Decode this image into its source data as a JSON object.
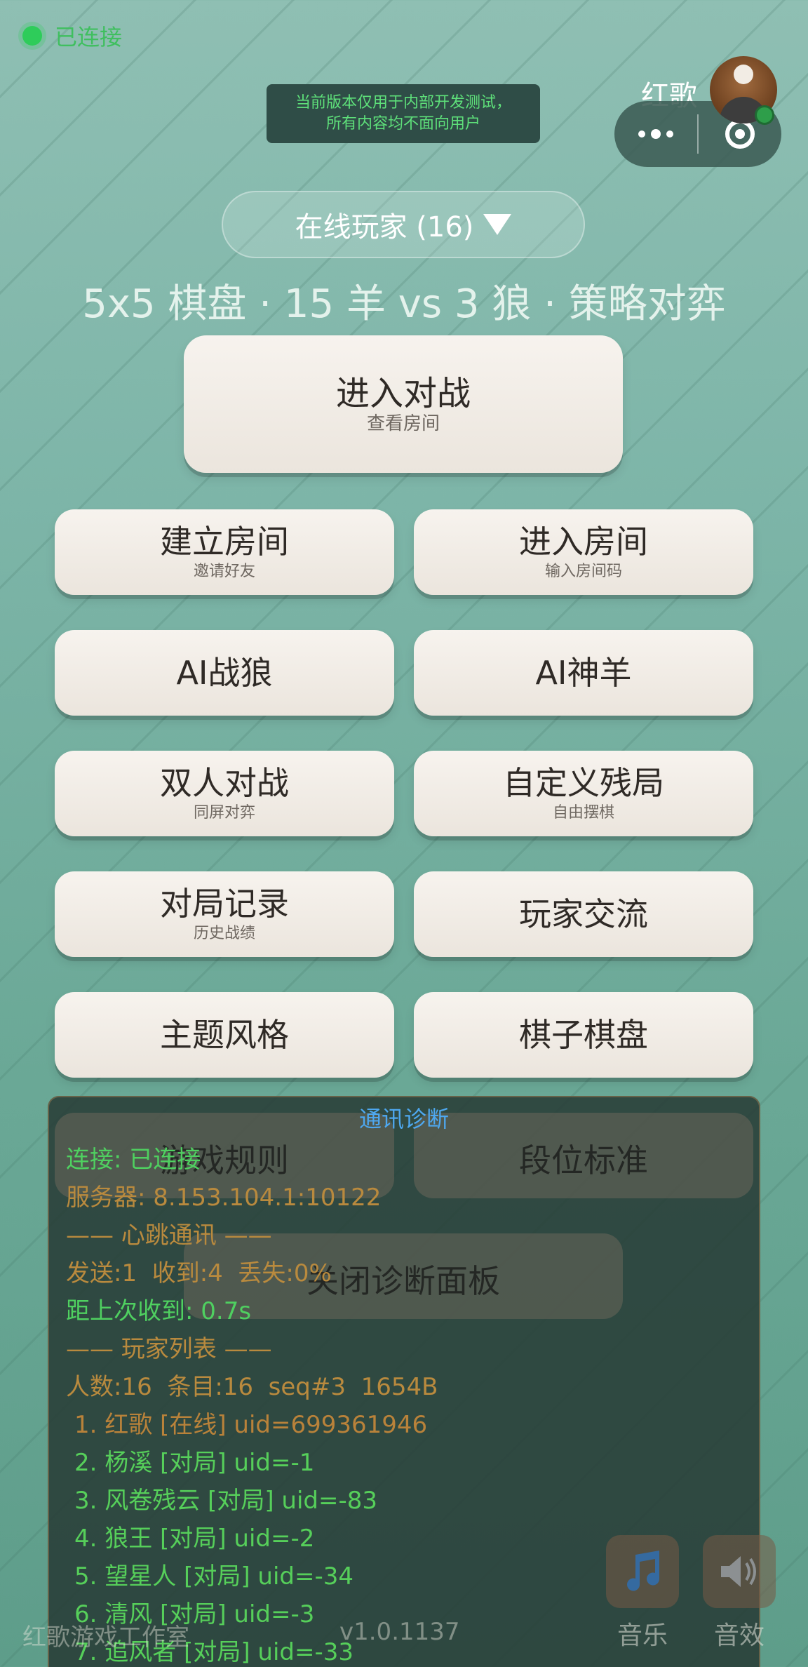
{
  "status": {
    "text": "已连接",
    "color": "#2ecc5a"
  },
  "notice": {
    "line1": "当前版本仅用于内部开发测试，",
    "line2": "所有内容均不面向用户"
  },
  "user": {
    "name": "红歌",
    "avatar_icon": "user-avatar-icon"
  },
  "capsule": {
    "more_icon": "more-dots-icon",
    "close_icon": "target-close-icon"
  },
  "online_players": {
    "label": "在线玩家 (16)",
    "icon": "triangle-down-icon"
  },
  "subtitle": "5x5 棋盘 · 15 羊 vs 3 狼 · 策略对弈",
  "menu": {
    "enter_battle": {
      "label": "进入对战",
      "sub": "查看房间"
    },
    "create_room": {
      "label": "建立房间",
      "sub": "邀请好友"
    },
    "join_room": {
      "label": "进入房间",
      "sub": "输入房间码"
    },
    "ai_wolf": {
      "label": "AI战狼"
    },
    "ai_sheep": {
      "label": "AI神羊"
    },
    "two_player": {
      "label": "双人对战",
      "sub": "同屏对弈"
    },
    "custom_endgame": {
      "label": "自定义残局",
      "sub": "自由摆棋"
    },
    "match_history": {
      "label": "对局记录",
      "sub": "历史战绩"
    },
    "player_chat": {
      "label": "玩家交流"
    },
    "theme": {
      "label": "主题风格"
    },
    "pieces_board": {
      "label": "棋子棋盘"
    },
    "game_rules": {
      "label": "游戏规则"
    },
    "rank_criteria": {
      "label": "段位标准"
    },
    "close_diag": {
      "label": "关闭诊断面板"
    }
  },
  "diagnostics": {
    "title": "通讯诊断",
    "connection": "连接: 已连接",
    "server": "服务器: 8.153.104.1:10122",
    "heartbeat_header": "—— 心跳通讯 ——",
    "heartbeat_stats": "发送:1  收到:4  丢失:0%",
    "last_received": "距上次收到: 0.7s",
    "players_header": "—— 玩家列表 ——",
    "players_summary": "人数:16  条目:16  seq#3  1654B",
    "players": [
      "1. 红歌 [在线] uid=699361946",
      "2. 杨溪 [对局] uid=-1",
      "3. 风卷残云 [对局] uid=-83",
      "4. 狼王 [对局] uid=-2",
      "5. 望星人 [对局] uid=-34",
      "6. 清风 [对局] uid=-3",
      "7. 追风者 [对局] uid=-33"
    ]
  },
  "footer": {
    "left": "红歌游戏工作室",
    "version": "v1.0.1137"
  },
  "corner": {
    "music_label": "音乐",
    "music_icon": "music-note-icon",
    "sfx_label": "音效",
    "sfx_icon": "speaker-icon"
  }
}
